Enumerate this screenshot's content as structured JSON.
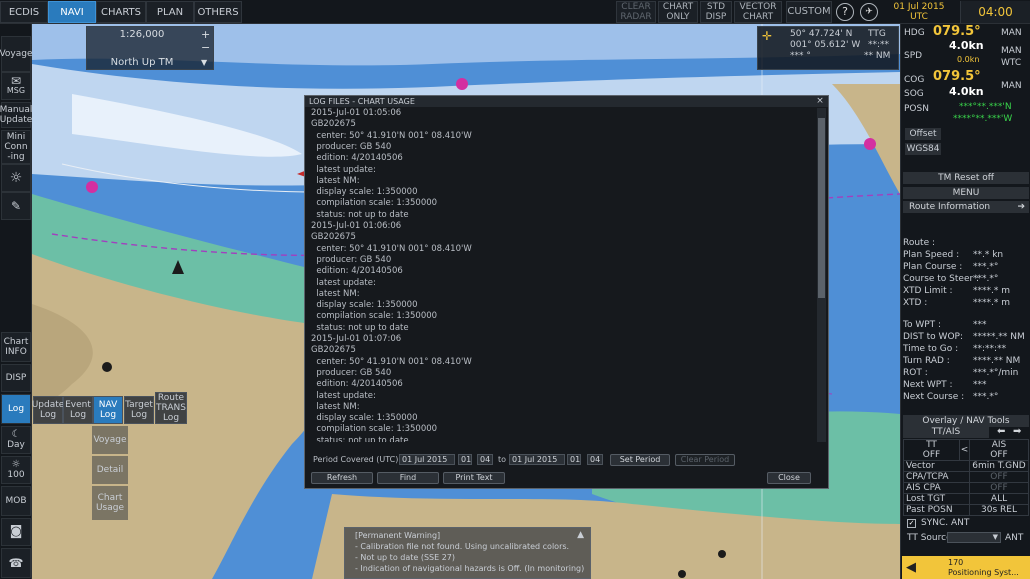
{
  "topbar": {
    "tabs": [
      "ECDIS",
      "NAVI",
      "CHARTS",
      "PLAN",
      "OTHERS"
    ],
    "active_tab": "NAVI",
    "clear_radar": "CLEAR RADAR",
    "chart_only": "CHART ONLY",
    "std_disp": "STD DISP",
    "vector_chart": "VECTOR CHART",
    "custom": "CUSTOM",
    "help_icon": "?",
    "date": "01 Jul 2015",
    "timezone": "UTC",
    "time": "04:00"
  },
  "leftbar": {
    "voyage": "Voyage",
    "msg": "MSG",
    "manual_update": "Manual Update",
    "mini_conning": "Mini Conn -ing",
    "chart_info": "Chart INFO",
    "disp": "DISP",
    "log": "Log",
    "day": "Day",
    "brightness": "100",
    "mob": "MOB"
  },
  "chart": {
    "scale": "1:26,000",
    "orientation": "North Up TM",
    "cursor_lat": "50° 47.724' N",
    "cursor_lon": "001° 05.612' W",
    "cursor_ttg": "TTG",
    "cursor_ttg_val": "**:**",
    "cursor_brg": "*** °",
    "cursor_nm": "** NM"
  },
  "log_menu": {
    "update_log": "Update Log",
    "event_log": "Event Log",
    "nav_log": "NAV Log",
    "target_log": "Target Log",
    "route_trans_log": "Route TRANS Log",
    "voyage": "Voyage",
    "detail": "Detail",
    "chart_usage": "Chart Usage"
  },
  "dialog": {
    "title": "LOG FILES - CHART USAGE",
    "lines": [
      "2015-Jul-01 01:05:06",
      "GB202675",
      "  center: 50° 41.910'N 001° 08.410'W",
      "  producer: GB 540",
      "  edition: 4/20140506",
      "  latest update:",
      "  latest NM:",
      "  display scale: 1:350000",
      "  compilation scale: 1:350000",
      "  status: not up to date",
      "2015-Jul-01 01:06:06",
      "GB202675",
      "  center: 50° 41.910'N 001° 08.410'W",
      "  producer: GB 540",
      "  edition: 4/20140506",
      "  latest update:",
      "  latest NM:",
      "  display scale: 1:350000",
      "  compilation scale: 1:350000",
      "  status: not up to date",
      "2015-Jul-01 01:07:06",
      "GB202675",
      "  center: 50° 41.910'N 001° 08.410'W",
      "  producer: GB 540",
      "  edition: 4/20140506",
      "  latest update:",
      "  latest NM:",
      "  display scale: 1:350000",
      "  compilation scale: 1:350000",
      "  status: not up to date"
    ],
    "period_label": "Period Covered (UTC) :",
    "from_date": "01 Jul 2015",
    "from_hour": "01",
    "from_min": "04",
    "to_label": "to",
    "to_date": "01 Jul 2015",
    "to_hour": "01",
    "to_min": "04",
    "set_period": "Set Period",
    "clear_period": "Clear Period",
    "refresh": "Refresh",
    "find": "Find",
    "print_text": "Print Text",
    "close": "Close"
  },
  "warning": {
    "title": "[Permanent Warning]",
    "lines": [
      "- Calibration file not found. Using uncalibrated colors.",
      "- Not up to date (SSE 27)",
      "- Indication of navigational hazards is Off. (In monitoring)"
    ]
  },
  "rpanel": {
    "hdg_label": "HDG",
    "hdg_value": "079.5°",
    "hdg_mode": "MAN",
    "spd_label": "SPD",
    "spd_value": "4.0kn",
    "spd_sub": "0.0kn",
    "spd_mode1": "MAN",
    "spd_mode2": "WTC",
    "cog_label": "COG",
    "cog_value": "079.5°",
    "sog_label": "SOG",
    "sog_value": "4.0kn",
    "sog_mode": "MAN",
    "posn_label": "POSN",
    "posn_lat": "***°**.***'N",
    "posn_lon": "****°**.***'W",
    "offset": "Offset",
    "wgs84": "WGS84",
    "tm_reset": "TM Reset off",
    "menu": "MENU",
    "route_info": "Route Information",
    "route_rows": [
      {
        "label": "Route :",
        "value": ""
      },
      {
        "label": "Plan Speed :",
        "value": "**.* kn"
      },
      {
        "label": "Plan Course :",
        "value": "***.*°"
      },
      {
        "label": "Course to Steer :",
        "value": "***.*°"
      },
      {
        "label": "XTD Limit :",
        "value": "****.* m"
      },
      {
        "label": "XTD :",
        "value": "****.* m"
      },
      {
        "label": "To WPT :",
        "value": "***"
      },
      {
        "label": "DIST to WOP:",
        "value": "*****.** NM"
      },
      {
        "label": "Time to Go :",
        "value": "**:**:**"
      },
      {
        "label": "Turn RAD :",
        "value": "****.** NM"
      },
      {
        "label": "ROT :",
        "value": "***.*°/min"
      },
      {
        "label": "Next WPT :",
        "value": "***"
      },
      {
        "label": "Next Course :",
        "value": "***.*°"
      }
    ],
    "overlay_tools": "Overlay / NAV Tools",
    "tt_ais": "TT/AIS",
    "tt": "TT",
    "tt_state": "OFF",
    "ais": "AIS",
    "ais_state": "OFF",
    "vector": "Vector",
    "vector_time": "6min",
    "vector_mode": "T.GND",
    "cpa_tcpa": "CPA/TCPA",
    "cpa_state": "OFF",
    "ais_cpa": "AIS CPA",
    "ais_cpa_state": "OFF",
    "lost_tgt": "Lost TGT",
    "lost_tgt_state": "ALL",
    "past_posn": "Past POSN",
    "past_posn_time": "30s",
    "past_posn_mode": "REL",
    "sync_ant": "SYNC. ANT",
    "tt_source": "TT Source:",
    "ant": "ANT",
    "alert_number": "170",
    "alert_text": "Positioning Syst..."
  }
}
